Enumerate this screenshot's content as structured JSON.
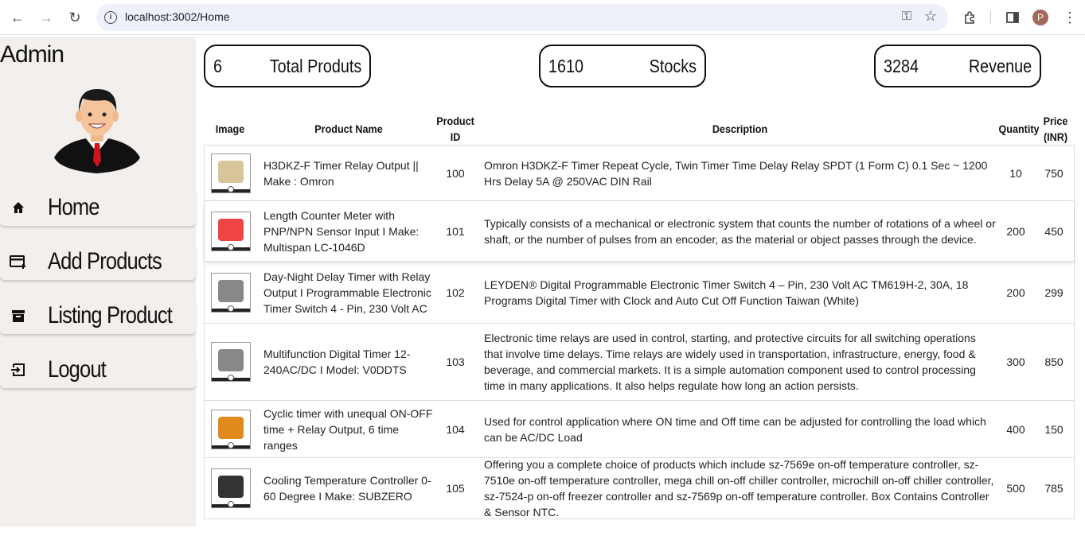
{
  "browser": {
    "url": "localhost:3002/Home",
    "profile_initial": "P"
  },
  "sidebar": {
    "title": "Admin",
    "items": [
      {
        "label": "Home",
        "icon": "home-icon"
      },
      {
        "label": "Add Products",
        "icon": "add-card-icon"
      },
      {
        "label": "Listing Product",
        "icon": "archive-icon"
      },
      {
        "label": "Logout",
        "icon": "logout-icon"
      }
    ]
  },
  "stats": [
    {
      "value": "6",
      "label": "Total Produts"
    },
    {
      "value": "1610",
      "label": "Stocks"
    },
    {
      "value": "3284",
      "label": "Revenue"
    }
  ],
  "table": {
    "headers": {
      "image": "Image",
      "name": "Product Name",
      "id_line1": "Product",
      "id_line2": "ID",
      "description": "Description",
      "quantity": "Quantity",
      "price_line1": "Price",
      "price_line2": "(INR)"
    },
    "rows": [
      {
        "name": "H3DKZ-F Timer Relay Output || Make : Omron",
        "id": "100",
        "description": "Omron H3DKZ-F Timer Repeat Cycle, Twin Timer Time Delay Relay SPDT (1 Form C) 0.1 Sec ~ 1200 Hrs Delay 5A @ 250VAC DIN Rail",
        "quantity": "10",
        "price": "750",
        "thumb_color": "#d8c59a"
      },
      {
        "name": "Length Counter Meter with PNP/NPN Sensor Input I Make: Multispan LC-1046D",
        "id": "101",
        "description": "Typically consists of a mechanical or electronic system that counts the number of rotations of a wheel or shaft, or the number of pulses from an encoder, as the material or object passes through the device.",
        "quantity": "200",
        "price": "450",
        "thumb_color": "#e44"
      },
      {
        "name": "Day-Night Delay Timer with Relay Output I Programmable Electronic Timer Switch 4 - Pin, 230 Volt AC",
        "id": "102",
        "description": "LEYDEN® Digital Programmable Electronic Timer Switch 4 – Pin, 230 Volt AC TM619H-2, 30A, 18 Programs Digital Timer with Clock and Auto Cut Off Function Taiwan (White)",
        "quantity": "200",
        "price": "299",
        "thumb_color": "#888"
      },
      {
        "name": "Multifunction Digital Timer 12-240AC/DC I Model: V0DDTS",
        "id": "103",
        "description": "Electronic time relays are used in control, starting, and protective circuits for all switching operations that involve time delays. Time relays are widely used in transportation, infrastructure, energy, food & beverage, and commercial markets. It is a simple automation component used to control processing time in many applications. It also helps regulate how long an action persists.",
        "quantity": "300",
        "price": "850",
        "thumb_color": "#888"
      },
      {
        "name": "Cyclic timer with unequal ON-OFF time + Relay Output, 6 time ranges",
        "id": "104",
        "description": "Used for control application where ON time and Off time can be adjusted for controlling the load which can be AC/DC Load",
        "quantity": "400",
        "price": "150",
        "thumb_color": "#e08a1e"
      },
      {
        "name": "Cooling Temperature Controller 0-60 Degree I Make: SUBZERO",
        "id": "105",
        "description": "Offering you a complete choice of products which include sz-7569e on-off temperature controller, sz-7510e on-off temperature controller, mega chill on-off chiller controller, microchill on-off chiller controller, sz-7524-p on-off freezer controller and sz-7569p on-off temperature controller. Box Contains Controller & Sensor NTC.",
        "quantity": "500",
        "price": "785",
        "thumb_color": "#333"
      }
    ]
  }
}
